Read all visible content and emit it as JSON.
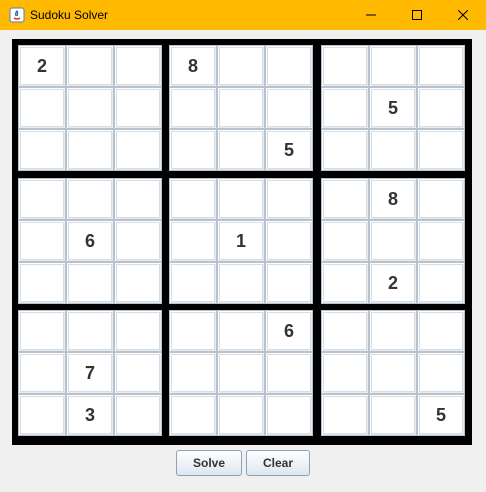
{
  "window": {
    "title": "Sudoku Solver"
  },
  "colors": {
    "titlebar": "#ffb900",
    "grid_lines": "#000000",
    "cell_background": "#ffffff",
    "digit": "#333333"
  },
  "board": {
    "rows": [
      [
        "2",
        "",
        "",
        "8",
        "",
        "",
        "",
        "",
        ""
      ],
      [
        "",
        "",
        "",
        "",
        "",
        "",
        "",
        "5",
        ""
      ],
      [
        "",
        "",
        "",
        "",
        "",
        "5",
        "",
        "",
        ""
      ],
      [
        "",
        "",
        "",
        "",
        "",
        "",
        "",
        "8",
        ""
      ],
      [
        "",
        "6",
        "",
        "",
        "1",
        "",
        "",
        "",
        ""
      ],
      [
        "",
        "",
        "",
        "",
        "",
        "",
        "",
        "2",
        ""
      ],
      [
        "",
        "",
        "",
        "",
        "",
        "6",
        "",
        "",
        ""
      ],
      [
        "",
        "7",
        "",
        "",
        "",
        "",
        "",
        "",
        ""
      ],
      [
        "",
        "3",
        "",
        "",
        "",
        "",
        "",
        "",
        "5"
      ]
    ]
  },
  "buttons": {
    "solve_label": "Solve",
    "clear_label": "Clear"
  }
}
